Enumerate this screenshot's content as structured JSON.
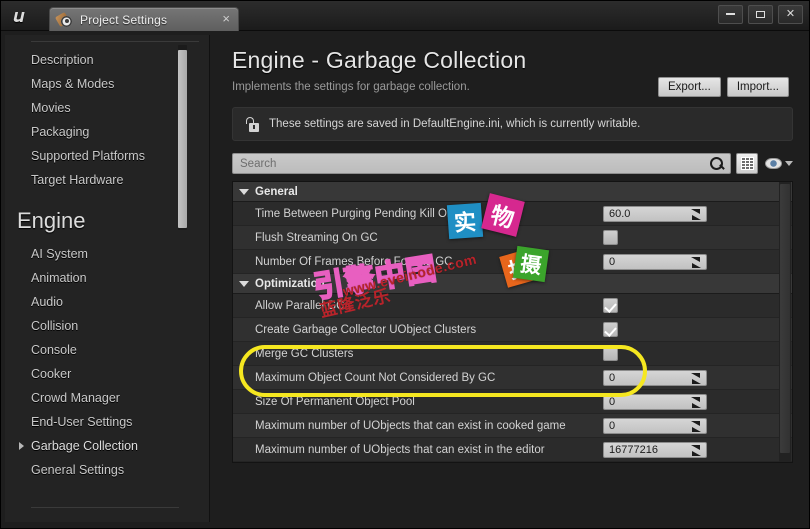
{
  "window": {
    "logo": "unreal-logo",
    "tab_title": "Project Settings",
    "close_glyph": "×",
    "minimize_label": "minimize",
    "maximize_label": "maximize",
    "close_label": "✕"
  },
  "sidebar": {
    "project_items": [
      {
        "label": "Description"
      },
      {
        "label": "Maps & Modes"
      },
      {
        "label": "Movies"
      },
      {
        "label": "Packaging"
      },
      {
        "label": "Supported Platforms"
      },
      {
        "label": "Target Hardware"
      }
    ],
    "group_title": "Engine",
    "engine_items": [
      {
        "label": "AI System",
        "selected": false
      },
      {
        "label": "Animation",
        "selected": false
      },
      {
        "label": "Audio",
        "selected": false
      },
      {
        "label": "Collision",
        "selected": false
      },
      {
        "label": "Console",
        "selected": false
      },
      {
        "label": "Cooker",
        "selected": false
      },
      {
        "label": "Crowd Manager",
        "selected": false
      },
      {
        "label": "End-User Settings",
        "selected": false
      },
      {
        "label": "Garbage Collection",
        "selected": true
      },
      {
        "label": "General Settings",
        "selected": false
      }
    ]
  },
  "header": {
    "title": "Engine - Garbage Collection",
    "subtitle": "Implements the settings for garbage collection.",
    "export_label": "Export...",
    "import_label": "Import...",
    "notice": "These settings are saved in DefaultEngine.ini, which is currently writable."
  },
  "search": {
    "placeholder": "Search",
    "value": ""
  },
  "sections": [
    {
      "name": "General",
      "rows": [
        {
          "label": "Time Between Purging Pending Kill Objects",
          "type": "number",
          "value": "60.0"
        },
        {
          "label": "Flush Streaming On GC",
          "type": "checkbox",
          "checked": false
        },
        {
          "label": "Number Of Frames Before Forcing GC",
          "type": "number",
          "value": "0"
        }
      ]
    },
    {
      "name": "Optimization",
      "rows": [
        {
          "label": "Allow Parallel GC",
          "type": "checkbox",
          "checked": true
        },
        {
          "label": "Create Garbage Collector UObject Clusters",
          "type": "checkbox",
          "checked": true
        },
        {
          "label": "Merge GC Clusters",
          "type": "checkbox",
          "checked": false
        },
        {
          "label": "Maximum Object Count Not Considered By GC",
          "type": "number",
          "value": "0"
        },
        {
          "label": "Size Of Permanent Object Pool",
          "type": "number",
          "value": "0"
        },
        {
          "label": "Maximum number of UObjects that can exist in cooked game",
          "type": "number",
          "value": "0"
        },
        {
          "label": "Maximum number of UObjects that can exist in the editor",
          "type": "number",
          "value": "16777216"
        }
      ]
    }
  ],
  "annotation": {
    "highlight_color": "#f5e720"
  },
  "watermarks": {
    "shi": "实",
    "wu": "物",
    "pai": "拍",
    "she": "摄",
    "engine_cn": "引擎中国",
    "url": "www.eveinode.com",
    "cn_line": "蓝隆泛乐"
  }
}
